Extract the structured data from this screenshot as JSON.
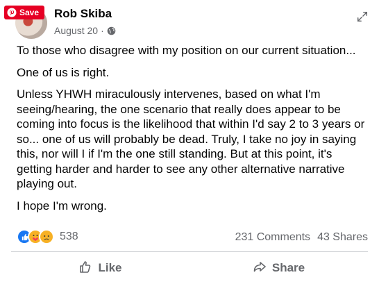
{
  "overlay": {
    "save_label": "Save"
  },
  "post": {
    "author": "Rob Skiba",
    "date": "August 20",
    "separator": "·",
    "paragraphs": [
      "To those who disagree with my position on our current situation...",
      "One of us is right.",
      "Unless YHWH miraculously intervenes, based on what I'm seeing/hearing, the one scenario that really does appear to be coming into focus is the likelihood that within I'd say 2 to 3 years or so... one of us will probably be dead. Truly, I take no joy in saying this, nor will I if I'm the one still standing. But at this point, it's getting harder and harder to see any other alternative narrative playing out.",
      "I hope I'm wrong."
    ]
  },
  "engagement": {
    "reaction_icons": [
      "like-icon",
      "care-icon",
      "sad-icon"
    ],
    "reaction_count": "538",
    "comments": "231 Comments",
    "shares": "43 Shares"
  },
  "actions": {
    "like_label": "Like",
    "share_label": "Share"
  },
  "colors": {
    "pinterest_red": "#e60023",
    "facebook_blue": "#1877f2",
    "secondary_text": "#65676b"
  }
}
